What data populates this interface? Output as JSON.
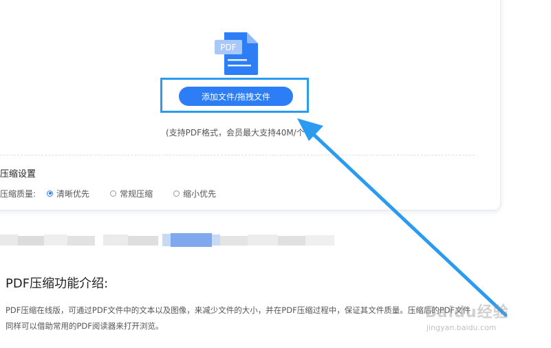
{
  "upload": {
    "file_icon_label": "PDF",
    "add_button_label": "添加文件/拖拽文件",
    "support_text": "(支持PDF格式，会员最大支持40M/个"
  },
  "settings": {
    "title": "压缩设置",
    "quality_label": "压缩质量:",
    "options": [
      {
        "label": "清晰优先",
        "selected": true
      },
      {
        "label": "常规压缩",
        "selected": false
      },
      {
        "label": "缩小优先",
        "selected": false
      }
    ]
  },
  "intro": {
    "title": "PDF压缩功能介绍:",
    "paragraph_line1": "PDF压缩在线版，可通过PDF文件中的文本以及图像，来减少文件的大小，并在PDF压缩过程中，保证其文件质量。压缩后的PDF文件",
    "paragraph_line2": "同样可以借助常用的PDF阅读器来打开浏览。"
  },
  "watermark": {
    "brand": "Baidu经验",
    "url": "jingyan.baidu.com"
  },
  "colors": {
    "accent": "#2d7df6",
    "annotation": "#2a9bf0"
  }
}
